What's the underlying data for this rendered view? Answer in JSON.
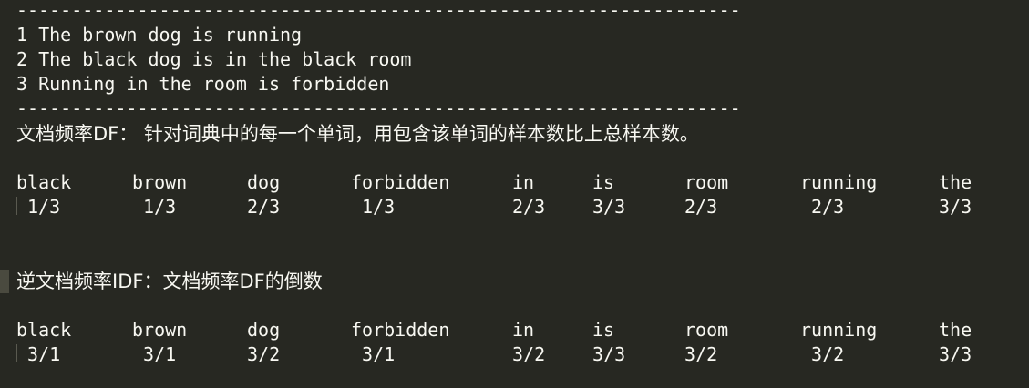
{
  "divider_top": "------------------------------------------------------------------",
  "sentences": [
    "1 The brown dog is running",
    "2 The black dog is in the black room",
    "3 Running in the room is forbidden"
  ],
  "divider_bottom": "------------------------------------------------------------------",
  "df_heading": "文档频率DF： 针对词典中的每一个单词，用包含该单词的样本数比上总样本数。",
  "df_table": {
    "words": [
      "black",
      "brown",
      "dog",
      "forbidden",
      "in",
      "is",
      "room",
      "running",
      "the"
    ],
    "values": [
      "1/3",
      "1/3",
      "2/3",
      "1/3",
      "2/3",
      "3/3",
      "2/3",
      "2/3",
      "3/3"
    ]
  },
  "idf_heading": "逆文档频率IDF：文档频率DF的倒数",
  "idf_table": {
    "words": [
      "black",
      "brown",
      "dog",
      "forbidden",
      "in",
      "is",
      "room",
      "running",
      "the"
    ],
    "values": [
      "3/1",
      "3/1",
      "3/2",
      "3/1",
      "3/2",
      "3/3",
      "3/2",
      "3/2",
      "3/3"
    ]
  }
}
